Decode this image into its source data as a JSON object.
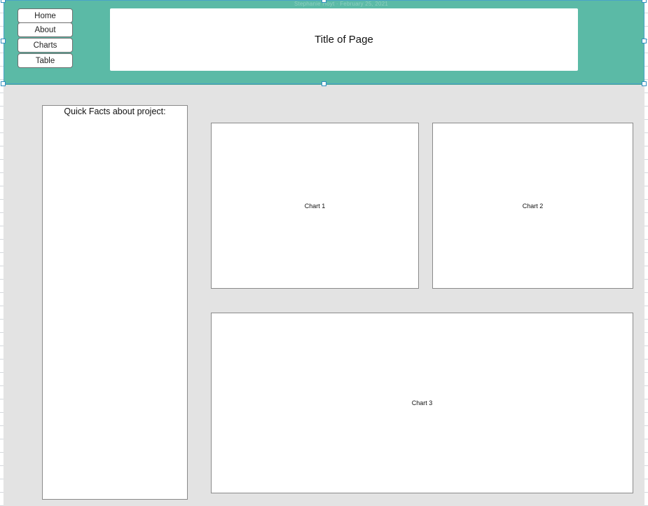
{
  "watermark": "Stephanie Hoyt · February 25, 2021",
  "nav": {
    "home_label": "Home",
    "about_label": "About",
    "charts_label": "Charts",
    "table_label": "Table"
  },
  "header": {
    "title": "Title of Page"
  },
  "quick_facts": {
    "title": "Quick Facts about project:"
  },
  "charts": {
    "chart1_label": "Chart 1",
    "chart2_label": "Chart 2",
    "chart3_label": "Chart 3"
  },
  "colors": {
    "header_bg": "#5bbaa6",
    "canvas_bg": "#e3e3e3",
    "selection": "#2f8fc0"
  }
}
